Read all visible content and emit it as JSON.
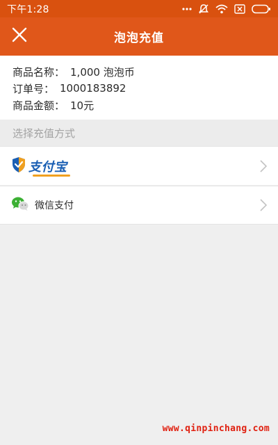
{
  "status_bar": {
    "time": "下午1:28",
    "icons": [
      "dots-icon",
      "muted-icon",
      "wifi-icon",
      "sim-icon",
      "battery-icon"
    ]
  },
  "header": {
    "title": "泡泡充值",
    "close_icon": "close-icon"
  },
  "order": {
    "rows": [
      {
        "label": "商品名称：",
        "value": "1,000 泡泡币"
      },
      {
        "label": "订单号：",
        "value": "1000183892"
      },
      {
        "label": "商品金额：",
        "value": "10元"
      }
    ]
  },
  "payment": {
    "section_title": "选择充值方式",
    "options": [
      {
        "id": "alipay",
        "label": "支付宝",
        "icon": "alipay-shield-icon"
      },
      {
        "id": "wechat",
        "label": "微信支付",
        "icon": "wechat-icon"
      }
    ]
  },
  "watermark": "www.qinpinchang.com",
  "colors": {
    "header": "#e0571a",
    "status_bar": "#d9510f",
    "alipay_blue": "#1a5fb4",
    "wechat_green": "#3cb034",
    "watermark_red": "#e02010"
  }
}
